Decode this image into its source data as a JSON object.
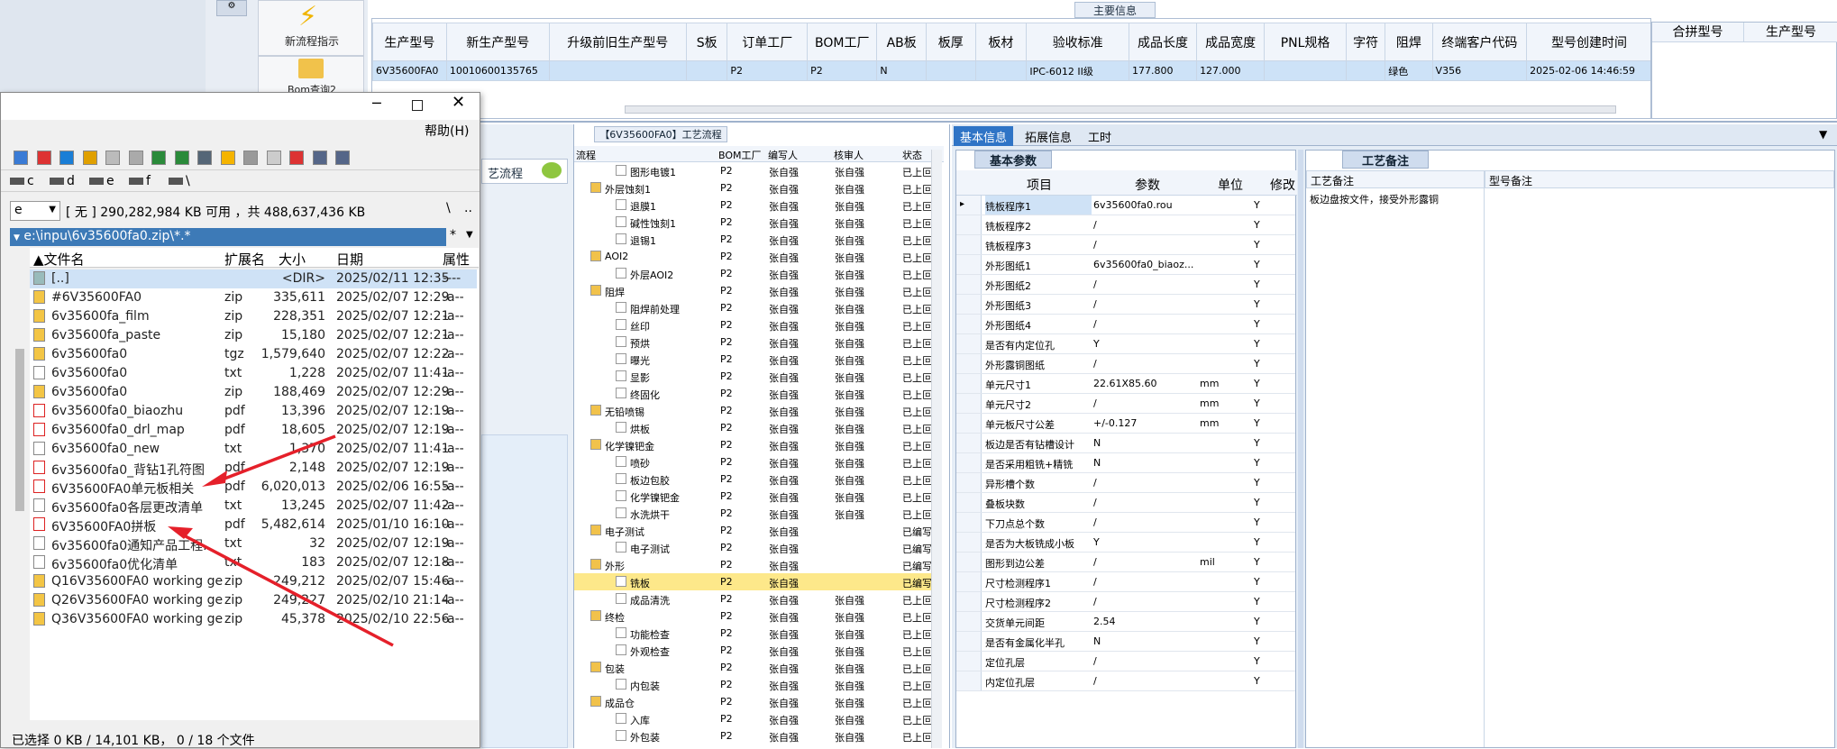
{
  "toolbar": {
    "new_flow_label": "新流程指示",
    "bom_query_label": "Bom查询2"
  },
  "main_info": {
    "title": "主要信息",
    "columns": [
      "生产型号",
      "新生产型号",
      "升级前旧生产型号",
      "S板",
      "订单工厂",
      "BOM工厂",
      "AB板",
      "板厚",
      "板材",
      "验收标准",
      "成品长度",
      "成品宽度",
      "PNL规格",
      "字符",
      "阻焊",
      "终端客户代码",
      "型号创建时间"
    ],
    "row": [
      "6V35600FA0",
      "10010600135765",
      "",
      "",
      "P2",
      "P2",
      "N",
      "",
      "",
      "IPC-6012 II级",
      "177.800",
      "127.000",
      "",
      "",
      "绿色",
      "V356",
      "2025-02-06 14:46:59"
    ],
    "merge_columns": [
      "合拼型号",
      "生产型号"
    ]
  },
  "file_manager": {
    "help": "帮助(H)",
    "drives": [
      "c",
      "d",
      "e",
      "f",
      "\\"
    ],
    "drive_select": "e",
    "free_space": "[ 无 ] 290,282,984 KB 可用 ，共 488,637,436 KB",
    "root_btn": "\\",
    "up_btn": "..",
    "path": "e:\\inpu\\6v35600fa0.zip\\*.*",
    "star": "*",
    "columns": [
      "文件名",
      "扩展名",
      "大小",
      "日期",
      "属性"
    ],
    "files": [
      {
        "name": "[..]",
        "ext": "",
        "size": "<DIR>",
        "date": "2025/02/11 12:35",
        "attr": "----",
        "icon": "up-folder"
      },
      {
        "name": "#6V35600FA0",
        "ext": "zip",
        "size": "335,611",
        "date": "2025/02/07 12:29",
        "attr": "-a--",
        "icon": "zip"
      },
      {
        "name": "6v35600fa_film",
        "ext": "zip",
        "size": "228,351",
        "date": "2025/02/07 12:21",
        "attr": "-a--",
        "icon": "zip"
      },
      {
        "name": "6v35600fa_paste",
        "ext": "zip",
        "size": "15,180",
        "date": "2025/02/07 12:21",
        "attr": "-a--",
        "icon": "zip"
      },
      {
        "name": "6v35600fa0",
        "ext": "tgz",
        "size": "1,579,640",
        "date": "2025/02/07 12:22",
        "attr": "-a--",
        "icon": "zip"
      },
      {
        "name": "6v35600fa0",
        "ext": "txt",
        "size": "1,228",
        "date": "2025/02/07 11:41",
        "attr": "-a--",
        "icon": "txt"
      },
      {
        "name": "6v35600fa0",
        "ext": "zip",
        "size": "188,469",
        "date": "2025/02/07 12:29",
        "attr": "-a--",
        "icon": "zip"
      },
      {
        "name": "6v35600fa0_biaozhu",
        "ext": "pdf",
        "size": "13,396",
        "date": "2025/02/07 12:19",
        "attr": "-a--",
        "icon": "pdf"
      },
      {
        "name": "6v35600fa0_drl_map",
        "ext": "pdf",
        "size": "18,605",
        "date": "2025/02/07 12:19",
        "attr": "-a--",
        "icon": "pdf"
      },
      {
        "name": "6v35600fa0_new",
        "ext": "txt",
        "size": "1,370",
        "date": "2025/02/07 11:41",
        "attr": "-a--",
        "icon": "txt"
      },
      {
        "name": "6v35600fa0_背钻1孔符图",
        "ext": "pdf",
        "size": "2,148",
        "date": "2025/02/07 12:19",
        "attr": "-a--",
        "icon": "pdf"
      },
      {
        "name": "6V35600FA0单元板相关",
        "ext": "pdf",
        "size": "6,020,013",
        "date": "2025/02/06 16:55",
        "attr": "-a--",
        "icon": "pdf"
      },
      {
        "name": "6v35600fa0各层更改清单",
        "ext": "txt",
        "size": "13,245",
        "date": "2025/02/07 11:42",
        "attr": "-a--",
        "icon": "txt"
      },
      {
        "name": "6V35600FA0拼板",
        "ext": "pdf",
        "size": "5,482,614",
        "date": "2025/01/10 16:10",
        "attr": "-a--",
        "icon": "pdf"
      },
      {
        "name": "6v35600fa0通知产品工程..",
        "ext": "txt",
        "size": "32",
        "date": "2025/02/07 12:19",
        "attr": "-a--",
        "icon": "txt"
      },
      {
        "name": "6v35600fa0优化清单",
        "ext": "txt",
        "size": "183",
        "date": "2025/02/07 12:18",
        "attr": "-a--",
        "icon": "txt"
      },
      {
        "name": "Q16V35600FA0 working ge..",
        "ext": "zip",
        "size": "249,212",
        "date": "2025/02/07 15:46",
        "attr": "-a--",
        "icon": "zip"
      },
      {
        "name": "Q26V35600FA0 working ge..",
        "ext": "zip",
        "size": "249,227",
        "date": "2025/02/10 21:14",
        "attr": "-a--",
        "icon": "zip"
      },
      {
        "name": "Q36V35600FA0 working ge..",
        "ext": "zip",
        "size": "45,378",
        "date": "2025/02/10 22:56",
        "attr": "-a--",
        "icon": "zip"
      }
    ],
    "status": "已选择 0 KB / 14,101 KB，  0 / 18 个文件"
  },
  "process_panel": {
    "title": "【6V35600FA0】工艺流程",
    "side_label": "艺流程",
    "columns": [
      "流程",
      "BOM工厂",
      "编写人",
      "核审人",
      "状态"
    ],
    "rows": [
      {
        "lvl": 1,
        "name": "图形电镀1",
        "bom": "P2",
        "writer": "张自强",
        "reviewer": "张自强",
        "status": "已上叵"
      },
      {
        "lvl": 0,
        "name": "外层蚀刻1",
        "bom": "P2",
        "writer": "张自强",
        "reviewer": "张自强",
        "status": "已上叵"
      },
      {
        "lvl": 1,
        "name": "退膜1",
        "bom": "P2",
        "writer": "张自强",
        "reviewer": "张自强",
        "status": "已上叵"
      },
      {
        "lvl": 1,
        "name": "碱性蚀刻1",
        "bom": "P2",
        "writer": "张自强",
        "reviewer": "张自强",
        "status": "已上叵"
      },
      {
        "lvl": 1,
        "name": "退锡1",
        "bom": "P2",
        "writer": "张自强",
        "reviewer": "张自强",
        "status": "已上叵"
      },
      {
        "lvl": 0,
        "name": "AOI2",
        "bom": "P2",
        "writer": "张自强",
        "reviewer": "张自强",
        "status": "已上叵"
      },
      {
        "lvl": 1,
        "name": "外层AOI2",
        "bom": "P2",
        "writer": "张自强",
        "reviewer": "张自强",
        "status": "已上叵"
      },
      {
        "lvl": 0,
        "name": "阻焊",
        "bom": "P2",
        "writer": "张自强",
        "reviewer": "张自强",
        "status": "已上叵"
      },
      {
        "lvl": 1,
        "name": "阻焊前处理",
        "bom": "P2",
        "writer": "张自强",
        "reviewer": "张自强",
        "status": "已上叵"
      },
      {
        "lvl": 1,
        "name": "丝印",
        "bom": "P2",
        "writer": "张自强",
        "reviewer": "张自强",
        "status": "已上叵"
      },
      {
        "lvl": 1,
        "name": "预烘",
        "bom": "P2",
        "writer": "张自强",
        "reviewer": "张自强",
        "status": "已上叵"
      },
      {
        "lvl": 1,
        "name": "曝光",
        "bom": "P2",
        "writer": "张自强",
        "reviewer": "张自强",
        "status": "已上叵"
      },
      {
        "lvl": 1,
        "name": "显影",
        "bom": "P2",
        "writer": "张自强",
        "reviewer": "张自强",
        "status": "已上叵"
      },
      {
        "lvl": 1,
        "name": "终固化",
        "bom": "P2",
        "writer": "张自强",
        "reviewer": "张自强",
        "status": "已上叵"
      },
      {
        "lvl": 0,
        "name": "无铅喷锡",
        "bom": "P2",
        "writer": "张自强",
        "reviewer": "张自强",
        "status": "已上叵"
      },
      {
        "lvl": 1,
        "name": "烘板",
        "bom": "P2",
        "writer": "张自强",
        "reviewer": "张自强",
        "status": "已上叵"
      },
      {
        "lvl": 0,
        "name": "化学镍钯金",
        "bom": "P2",
        "writer": "张自强",
        "reviewer": "张自强",
        "status": "已上叵"
      },
      {
        "lvl": 1,
        "name": "喷砂",
        "bom": "P2",
        "writer": "张自强",
        "reviewer": "张自强",
        "status": "已上叵"
      },
      {
        "lvl": 1,
        "name": "板边包胶",
        "bom": "P2",
        "writer": "张自强",
        "reviewer": "张自强",
        "status": "已上叵"
      },
      {
        "lvl": 1,
        "name": "化学镍钯金",
        "bom": "P2",
        "writer": "张自强",
        "reviewer": "张自强",
        "status": "已上叵"
      },
      {
        "lvl": 1,
        "name": "水洗烘干",
        "bom": "P2",
        "writer": "张自强",
        "reviewer": "张自强",
        "status": "已上叵"
      },
      {
        "lvl": 0,
        "name": "电子测试",
        "bom": "P2",
        "writer": "张自强",
        "reviewer": "",
        "status": "已编写"
      },
      {
        "lvl": 1,
        "name": "电子测试",
        "bom": "P2",
        "writer": "张自强",
        "reviewer": "",
        "status": "已编写"
      },
      {
        "lvl": 0,
        "name": "外形",
        "bom": "P2",
        "writer": "张自强",
        "reviewer": "",
        "status": "已编写"
      },
      {
        "lvl": 1,
        "name": "铣板",
        "bom": "P2",
        "writer": "张自强",
        "reviewer": "",
        "status": "已编写",
        "sel": true
      },
      {
        "lvl": 1,
        "name": "成品清洗",
        "bom": "P2",
        "writer": "张自强",
        "reviewer": "张自强",
        "status": "已上叵"
      },
      {
        "lvl": 0,
        "name": "终检",
        "bom": "P2",
        "writer": "张自强",
        "reviewer": "张自强",
        "status": "已上叵"
      },
      {
        "lvl": 1,
        "name": "功能检查",
        "bom": "P2",
        "writer": "张自强",
        "reviewer": "张自强",
        "status": "已上叵"
      },
      {
        "lvl": 1,
        "name": "外观检查",
        "bom": "P2",
        "writer": "张自强",
        "reviewer": "张自强",
        "status": "已上叵"
      },
      {
        "lvl": 0,
        "name": "包装",
        "bom": "P2",
        "writer": "张自强",
        "reviewer": "张自强",
        "status": "已上叵"
      },
      {
        "lvl": 1,
        "name": "内包装",
        "bom": "P2",
        "writer": "张自强",
        "reviewer": "张自强",
        "status": "已上叵"
      },
      {
        "lvl": 0,
        "name": "成品仓",
        "bom": "P2",
        "writer": "张自强",
        "reviewer": "张自强",
        "status": "已上叵"
      },
      {
        "lvl": 1,
        "name": "入库",
        "bom": "P2",
        "writer": "张自强",
        "reviewer": "张自强",
        "status": "已上叵"
      },
      {
        "lvl": 1,
        "name": "外包装",
        "bom": "P2",
        "writer": "张自强",
        "reviewer": "张自强",
        "status": "已上叵"
      }
    ]
  },
  "info_tabs": [
    "基本信息",
    "拓展信息",
    "工时"
  ],
  "basic": {
    "tab": "基本参数",
    "columns": [
      "项目",
      "参数",
      "单位",
      "修改"
    ],
    "rows": [
      [
        "铣板程序1",
        "6v35600fa0.rou",
        "",
        "Y"
      ],
      [
        "铣板程序2",
        "/",
        "",
        "Y"
      ],
      [
        "铣板程序3",
        "/",
        "",
        "Y"
      ],
      [
        "外形图纸1",
        "6v35600fa0_biaoz...",
        "",
        "Y"
      ],
      [
        "外形图纸2",
        "/",
        "",
        "Y"
      ],
      [
        "外形图纸3",
        "/",
        "",
        "Y"
      ],
      [
        "外形图纸4",
        "/",
        "",
        "Y"
      ],
      [
        "是否有内定位孔",
        "Y",
        "",
        "Y"
      ],
      [
        "外形露铜图纸",
        "/",
        "",
        "Y"
      ],
      [
        "单元尺寸1",
        "22.61X85.60",
        "mm",
        "Y"
      ],
      [
        "单元尺寸2",
        "/",
        "mm",
        "Y"
      ],
      [
        "单元板尺寸公差",
        "+/-0.127",
        "mm",
        "Y"
      ],
      [
        "板边是否有钻槽设计",
        "N",
        "",
        "Y"
      ],
      [
        "是否采用粗铣+精铣",
        "N",
        "",
        "Y"
      ],
      [
        "异形槽个数",
        "/",
        "",
        "Y"
      ],
      [
        "叠板块数",
        "/",
        "",
        "Y"
      ],
      [
        "下刀点总个数",
        "/",
        "",
        "Y"
      ],
      [
        "是否为大板铣成小板",
        "Y",
        "",
        "Y"
      ],
      [
        "图形到边公差",
        "/",
        "mil",
        "Y"
      ],
      [
        "尺寸检测程序1",
        "/",
        "",
        "Y"
      ],
      [
        "尺寸检测程序2",
        "/",
        "",
        "Y"
      ],
      [
        "交货单元间距",
        "2.54",
        "",
        "Y"
      ],
      [
        "是否有金属化半孔",
        "N",
        "",
        "Y"
      ],
      [
        "定位孔层",
        "/",
        "",
        "Y"
      ],
      [
        "内定位孔层",
        "/",
        "",
        "Y"
      ]
    ]
  },
  "remark": {
    "tab": "工艺备注",
    "columns": [
      "工艺备注",
      "型号备注"
    ],
    "text": "板边盘按文件，接受外形露铜"
  }
}
